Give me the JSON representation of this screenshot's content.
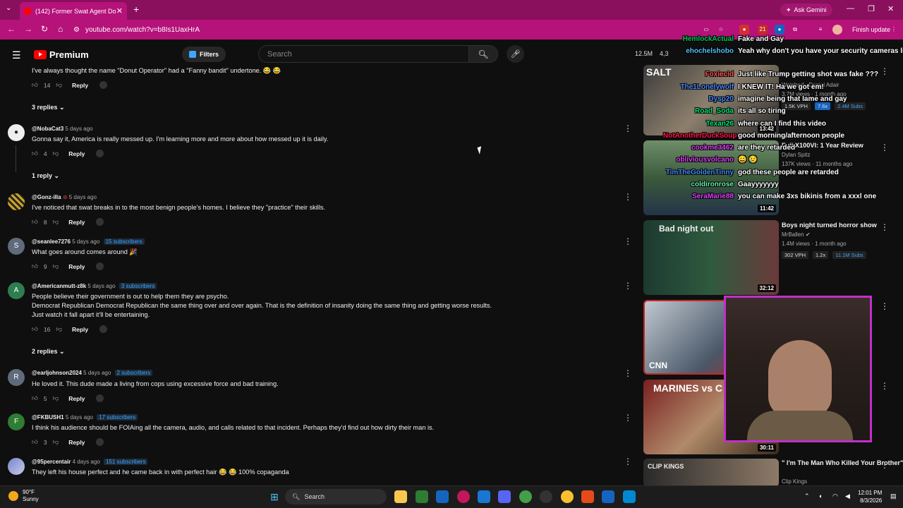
{
  "browser": {
    "tab_title": "(142) Former Swat Agent Donut",
    "url": "youtube.com/watch?v=b8Is1UaxHrA",
    "ask_gemini": "Ask Gemini",
    "finish_update": "Finish update",
    "ext_badge": "21"
  },
  "youtube": {
    "logo": "Premium",
    "filters": "Filters",
    "search_placeholder": "Search",
    "stats": {
      "views": "12.5M",
      "watching": "4,3"
    }
  },
  "comments": [
    {
      "text": "I've always thought the name \"Donut Operator\" had a \"Fanny bandit\" undertone. 😂 😂",
      "likes": "14",
      "reply": "Reply"
    },
    {
      "toggle": "3 replies"
    },
    {
      "author": "@NobaCat3",
      "time": "5 days ago",
      "text": "Gonna say it, America is really messed up. I'm learning more and more about how messed up it is daily.",
      "likes": "4",
      "reply": "Reply"
    },
    {
      "toggle": "1 reply"
    },
    {
      "author": "@Gonz-illa",
      "time": "5 days ago",
      "text": "I've noticed that swat breaks in to the most benign people's homes. I believe they \"practice\" their skills.",
      "likes": "8",
      "reply": "Reply"
    },
    {
      "author": "@seanlee7276",
      "time": "5 days ago",
      "subs": "15 subscribers",
      "text": "What goes around comes around 🎉",
      "likes": "9",
      "reply": "Reply",
      "avatar": "S",
      "color": "#5f6b7a"
    },
    {
      "author": "@Americanmutt-z8k",
      "time": "5 days ago",
      "subs": "3 subscribers",
      "lines": [
        "People believe their government is out to help them they are psycho.",
        "Democrat Republican Democrat Republican the same thing over and over again. That is the definition of insanity doing the same thing and getting worse results.",
        "Just watch it fall apart it'll be entertaining."
      ],
      "likes": "16",
      "reply": "Reply",
      "avatar": "A",
      "color": "#2e7d4f"
    },
    {
      "toggle": "2 replies"
    },
    {
      "author": "@earljohnson2024",
      "time": "5 days ago",
      "subs": "2 subscribers",
      "text": "He loved it.  This dude made a living from cops using excessive force and bad training.",
      "likes": "5",
      "reply": "Reply",
      "avatar": "R",
      "color": "#5f6b7a"
    },
    {
      "author": "@FKBUSH1",
      "time": "5 days ago",
      "subs": "17 subscribers",
      "text": "I think his audience should be FOIAing all the camera, audio, and calls related to that incident. Perhaps they'd find out how dirty their man is.",
      "likes": "3",
      "reply": "Reply",
      "avatar": "F",
      "color": "#2e7d32"
    },
    {
      "author": "@95percentair",
      "time": "4 days ago",
      "subs": "151 subscribers",
      "text": "They left his house perfect and he came back in with perfect hair 😂 😂 100% copaganda",
      "likes": "",
      "reply": "Reply"
    }
  ],
  "sidebar": [
    {
      "title": "",
      "channel": "Watched · Daniel Adair",
      "meta": "3.7M views · 1 month ago",
      "tags": [
        "1.5K VPH",
        "7.6x",
        "2.4M Subs"
      ],
      "duration": "13:42",
      "thumb_text": "SALT"
    },
    {
      "title": "Fuji X100VI: 1 Year Review",
      "channel": "Dylan Spitz",
      "meta": "137K views · 11 months ago",
      "tags": [],
      "duration": "11:42",
      "thumb_text": ""
    },
    {
      "title": "Boys night turned horror show",
      "channel": "MrBallen",
      "meta": "1.4M views · 1 month ago",
      "tags": [
        "302 VPH",
        "1.2x",
        "11.1M Subs"
      ],
      "duration": "32:12",
      "thumb_text": "Bad night out"
    },
    {
      "title": "",
      "channel": "",
      "meta": "",
      "tags": [],
      "duration": "",
      "thumb_text": "CNN"
    },
    {
      "title": "",
      "channel": "",
      "meta": "",
      "tags": [],
      "duration": "30:11",
      "thumb_text": "MARINES vs C"
    },
    {
      "title": "\" I'm The Man Who Killed Your Brother\" (Ending Scene) | Hell ...",
      "channel": "Clip Kings",
      "meta": "",
      "tags": [],
      "duration": "",
      "thumb_text": "CLIP KINGS"
    }
  ],
  "chat": [
    {
      "user": "HemlockActual",
      "msg": "Fake and Gay",
      "color": "#00c853"
    },
    {
      "user": "ehochelshobo",
      "msg": "Yeah why don't you have your security cameras live streaming",
      "color": "#4fc3f7"
    },
    {
      "user": "Foxiecid",
      "msg": "Just like Trump getting shot was fake ???",
      "color": "#ff5252"
    },
    {
      "user": "The1Lonelywolf",
      "msg": "I KNEW IT! Ha we got em!",
      "color": "#448aff"
    },
    {
      "user": "Dysp20",
      "msg": "imagine being that lame and gay",
      "color": "#448aff"
    },
    {
      "user": "Road_Soda",
      "msg": "its all so tiring",
      "color": "#00e676"
    },
    {
      "user": "Texan26",
      "msg": "where can I find this video",
      "color": "#00e676"
    },
    {
      "user": "NotAnotherDuckSoup",
      "msg": "good morning/afternoon people",
      "color": "#ff1744"
    },
    {
      "user": "cookme3462",
      "msg": "are they retarded",
      "color": "#e040fb"
    },
    {
      "user": "obliviousvolcano",
      "msg": "😄 😢",
      "color": "#e040fb"
    },
    {
      "user": "TimTheGoldenTinny",
      "msg": "god these people are retarded",
      "color": "#448aff"
    },
    {
      "user": "coldironrose",
      "msg": "Gaayyyyyyy",
      "color": "#69f0ae"
    },
    {
      "user": "SeraMarie88",
      "msg": "you can make 3xs bikinis from a xxxl one",
      "color": "#e040fb"
    }
  ],
  "taskbar": {
    "temp": "90°F",
    "condition": "Sunny",
    "search": "Search",
    "time": "12:01 PM",
    "date": "8/3/2026"
  }
}
